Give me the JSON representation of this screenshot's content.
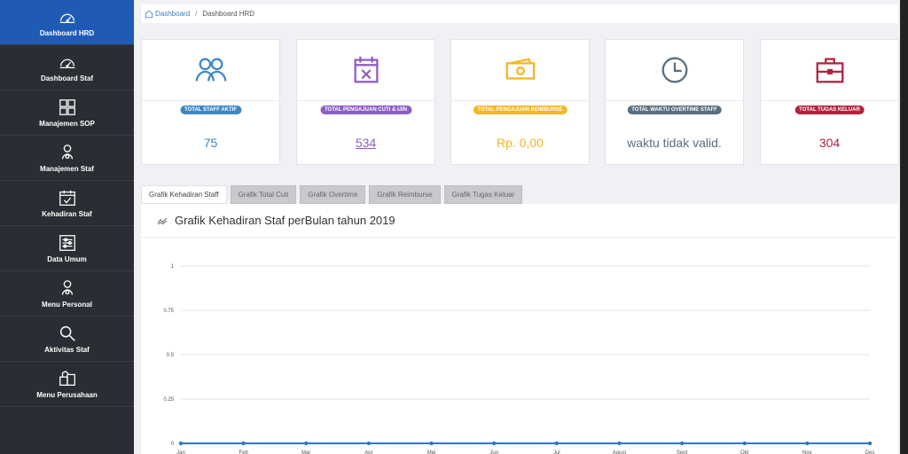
{
  "sidebar": {
    "items": [
      {
        "label": "Dashboard HRD",
        "icon": "speedometer-icon",
        "active": true
      },
      {
        "label": "Dashboard Staf",
        "icon": "speedometer-icon"
      },
      {
        "label": "Manajemen SOP",
        "icon": "grid-icon"
      },
      {
        "label": "Manajemen Staf",
        "icon": "user-badge-icon"
      },
      {
        "label": "Kehadiran Staf",
        "icon": "calendar-check-icon"
      },
      {
        "label": "Data Umum",
        "icon": "sliders-icon"
      },
      {
        "label": "Menu Personal",
        "icon": "user-badge-icon"
      },
      {
        "label": "Aktivitas Staf",
        "icon": "search-icon"
      },
      {
        "label": "Menu Perusahaan",
        "icon": "boxes-icon"
      }
    ]
  },
  "breadcrumb": {
    "home": "Dashboard",
    "current": "Dashboard HRD"
  },
  "cards": [
    {
      "label": "TOTAL STAFF AKTIF",
      "value": "75",
      "color": "#3f87c6",
      "icon": "users-icon"
    },
    {
      "label": "TOTAL PENGAJUAN CUTI & IJIN",
      "value": "534",
      "color": "#8e5fc2",
      "icon": "calendar-x-icon"
    },
    {
      "label": "TOTAL PENGAJUAN REIMBURSE",
      "value": "Rp. 0,00",
      "color": "#f4b722",
      "icon": "money-icon"
    },
    {
      "label": "TOTAL WAKTU OVERTIME STAFF",
      "value": "waktu tidak valid.",
      "color": "#5a6f80",
      "icon": "clock-icon"
    },
    {
      "label": "TOTAL TUGAS KELUAR",
      "value": "304",
      "color": "#b0233f",
      "icon": "briefcase-icon"
    }
  ],
  "tabs": [
    "Grafik Kehadiran Staff",
    "Grafik Total Cuti",
    "Grafik Overtime",
    "Grafik Reimburse",
    "Grafik Tugas Keluar"
  ],
  "chart_title": "Grafik Kehadiran Staf perBulan tahun 2019",
  "chart_data": {
    "type": "line",
    "title": "Grafik Kehadiran Staf perBulan tahun 2019",
    "categories": [
      "Jan",
      "Feb",
      "Mar",
      "Apr",
      "Mei",
      "Jun",
      "Jul",
      "Agust",
      "Sept",
      "Okt",
      "Nov",
      "Des"
    ],
    "series": [
      {
        "values": [
          0,
          0,
          0,
          0,
          0,
          0,
          0,
          0,
          0,
          0,
          0,
          0
        ],
        "color": "#2b78c6"
      }
    ],
    "yticks": [
      "1",
      "0.75",
      "0.5",
      "0.25",
      "0"
    ],
    "ylim": [
      0,
      1
    ],
    "grid": true
  }
}
